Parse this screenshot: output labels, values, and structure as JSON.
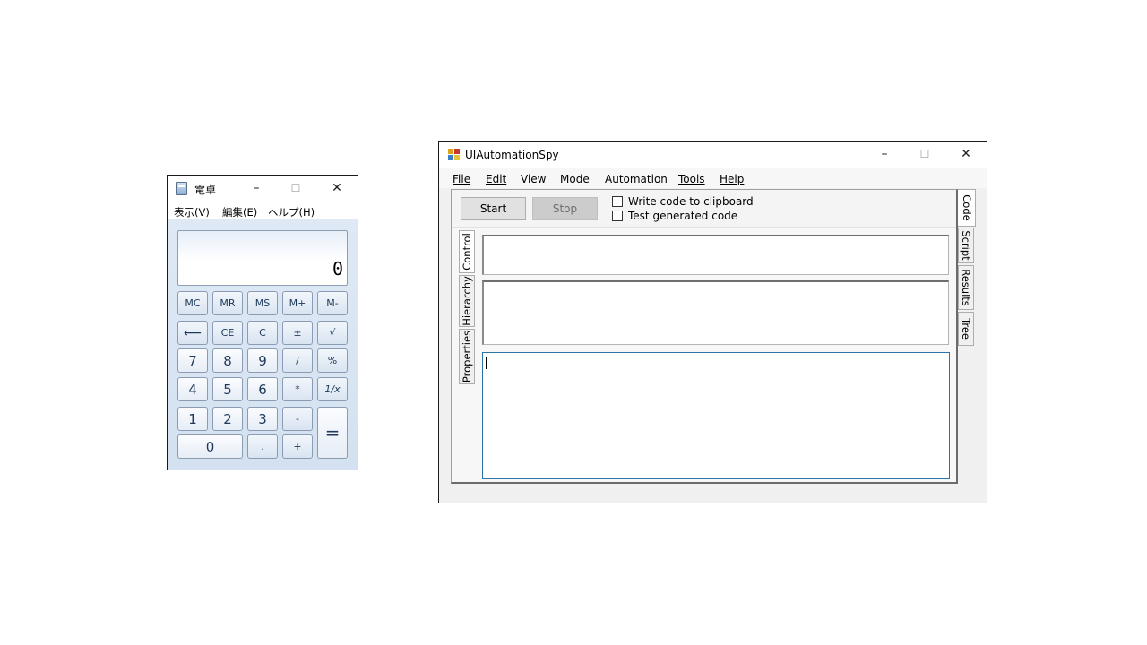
{
  "calculator": {
    "title": "電卓",
    "window_buttons": {
      "minimize": "–",
      "maximize": "☐",
      "close": "✕"
    },
    "menu": [
      "表示(V)",
      "編集(E)",
      "ヘルプ(H)"
    ],
    "display": "0",
    "buttons": {
      "mc": "MC",
      "mr": "MR",
      "ms": "MS",
      "mplus": "M+",
      "mminus": "M-",
      "back": "⟵",
      "ce": "CE",
      "c": "C",
      "plusminus": "±",
      "sqrt": "√",
      "n7": "7",
      "n8": "8",
      "n9": "9",
      "div": "/",
      "pct": "%",
      "n4": "4",
      "n5": "5",
      "n6": "6",
      "mul": "*",
      "recip": "1/x",
      "n1": "1",
      "n2": "2",
      "n3": "3",
      "sub": "-",
      "eq": "=",
      "n0": "0",
      "dot": ".",
      "add": "+"
    }
  },
  "spy": {
    "title": "UIAutomationSpy",
    "window_buttons": {
      "minimize": "–",
      "maximize": "☐",
      "close": "✕"
    },
    "menu": {
      "file": "File",
      "edit": "Edit",
      "view": "View",
      "mode": "Mode",
      "automation": "Automation",
      "tools": "Tools",
      "help": "Help"
    },
    "start_label": "Start",
    "stop_label": "Stop",
    "write_code_label": "Write code to clipboard",
    "test_code_label": "Test generated code",
    "left_tabs": {
      "control": "Control",
      "hierarchy": "Hierarchy",
      "properties": "Properties"
    },
    "right_tabs": {
      "code": "Code",
      "script": "Script",
      "results": "Results",
      "tree": "Tree"
    }
  }
}
